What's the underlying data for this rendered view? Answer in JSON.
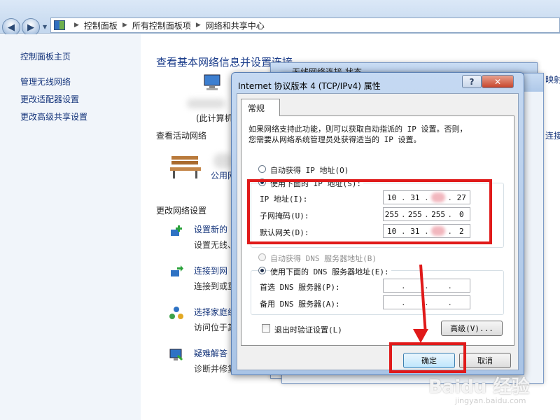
{
  "address_bar": {
    "crumbs": [
      "控制面板",
      "所有控制面板项",
      "网络和共享中心"
    ],
    "icons": {
      "back": "back-arrow-icon",
      "forward": "forward-arrow-icon",
      "dropdown": "chevron-down-icon",
      "control_panel": "control-panel-icon"
    }
  },
  "left_pane": {
    "home": "控制面板主页",
    "links": [
      "管理无线网络",
      "更改适配器设置",
      "更改高级共享设置"
    ]
  },
  "main": {
    "title": "查看基本网络信息并设置连接",
    "computer_label": "(此计算机",
    "active_networks": "查看活动网络",
    "public_network": "公用网",
    "change_settings": "更改网络设置",
    "tasks": [
      {
        "link": "设置新的",
        "desc": "设置无线、",
        "icon": "new-connection-icon"
      },
      {
        "link": "连接到网",
        "desc": "连接到或重",
        "icon": "connect-network-icon"
      },
      {
        "link": "选择家庭组",
        "desc": "访问位于其",
        "icon": "homegroup-icon"
      },
      {
        "link": "疑难解答",
        "desc": "诊断并修复",
        "icon": "troubleshoot-icon"
      }
    ],
    "right_link": "连接",
    "right_top": "映射"
  },
  "back_dialog": {
    "title": "无线网络连接 状态"
  },
  "dialog": {
    "title": "Internet 协议版本 4 (TCP/IPv4) 属性",
    "tab": "常规",
    "description": [
      "如果网络支持此功能，则可以获取自动指派的 IP 设置。否则，",
      "您需要从网络系统管理员处获得适当的 IP 设置。"
    ],
    "auto_ip": "自动获得 IP 地址(O)",
    "manual_ip": "使用下面的 IP 地址(S):",
    "ip_label": "IP 地址(I):",
    "ip_value": [
      "10",
      "31",
      "",
      "27"
    ],
    "mask_label": "子网掩码(U):",
    "mask_value": [
      "255",
      "255",
      "255",
      "0"
    ],
    "gateway_label": "默认网关(D):",
    "gateway_value": [
      "10",
      "31",
      "",
      "2"
    ],
    "auto_dns": "自动获得 DNS 服务器地址(B)",
    "manual_dns": "使用下面的 DNS 服务器地址(E):",
    "dns1_label": "首选 DNS 服务器(P):",
    "dns2_label": "备用 DNS 服务器(A):",
    "validate": "退出时验证设置(L)",
    "advanced": "高级(V)...",
    "ok": "确定",
    "cancel": "取消",
    "help": "?",
    "close": "✕"
  },
  "watermark": {
    "logo": "Baidu 经验",
    "url": "jingyan.baidu.com"
  },
  "colors": {
    "annotation": "#e01a1a",
    "link": "#13337a",
    "title": "#1b3d8b"
  }
}
